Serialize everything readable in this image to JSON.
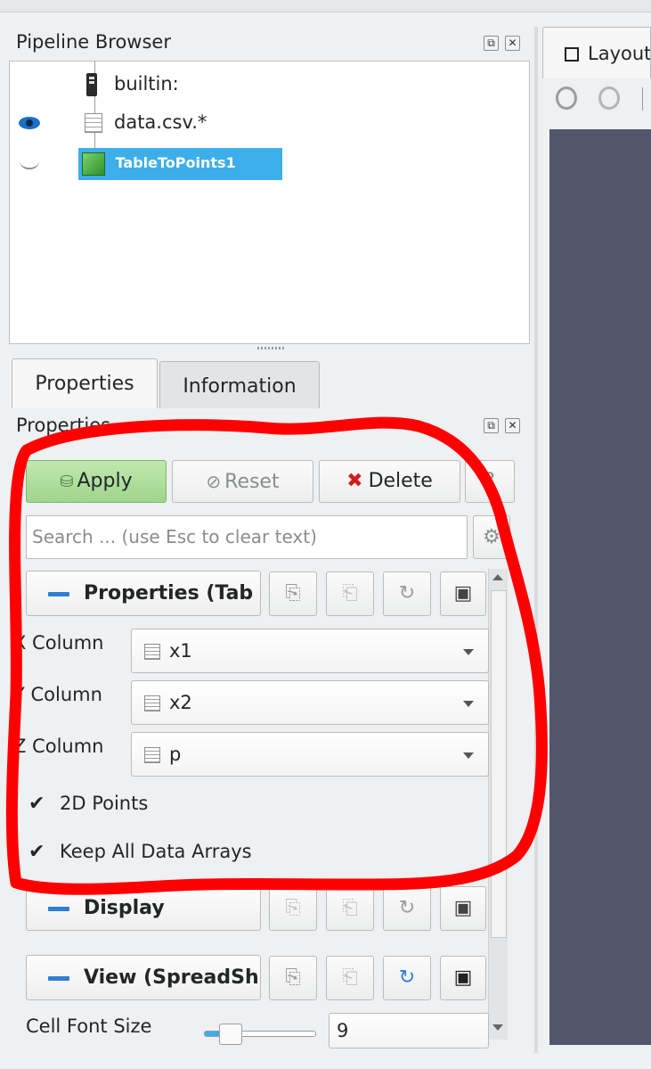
{
  "pipeline": {
    "title": "Pipeline Browser",
    "items": [
      {
        "label": "builtin:",
        "icon": "server-icon"
      },
      {
        "label": "data.csv.*",
        "icon": "table-icon",
        "visible": true
      },
      {
        "label": "TableToPoints1",
        "icon": "cube-icon",
        "visible": false,
        "selected": true
      }
    ]
  },
  "layout_tab": {
    "label": "Layout"
  },
  "tabs": [
    {
      "label": "Properties",
      "active": true
    },
    {
      "label": "Information",
      "active": false
    }
  ],
  "properties_panel": {
    "title": "Properties",
    "apply_label": "Apply",
    "reset_label": "Reset",
    "delete_label": "Delete",
    "search_placeholder": "Search ... (use Esc to clear text)"
  },
  "sections": [
    {
      "title": "Properties (Tab"
    },
    {
      "title": "Display"
    },
    {
      "title": "View (SpreadSh"
    }
  ],
  "fields": [
    {
      "label": "X Column",
      "value": "x1"
    },
    {
      "label": "Y Column",
      "value": "x2"
    },
    {
      "label": "Z Column",
      "value": "p"
    }
  ],
  "checkboxes": [
    {
      "label": "2D Points",
      "checked": true
    },
    {
      "label": "Keep All Data Arrays",
      "checked": true
    }
  ],
  "cell_font": {
    "label": "Cell Font Size",
    "value": "9"
  },
  "colors": {
    "selection": "#3daee9",
    "apply": "#a9dd97",
    "annotation": "#ff0000",
    "view_bg": "#52566d"
  }
}
